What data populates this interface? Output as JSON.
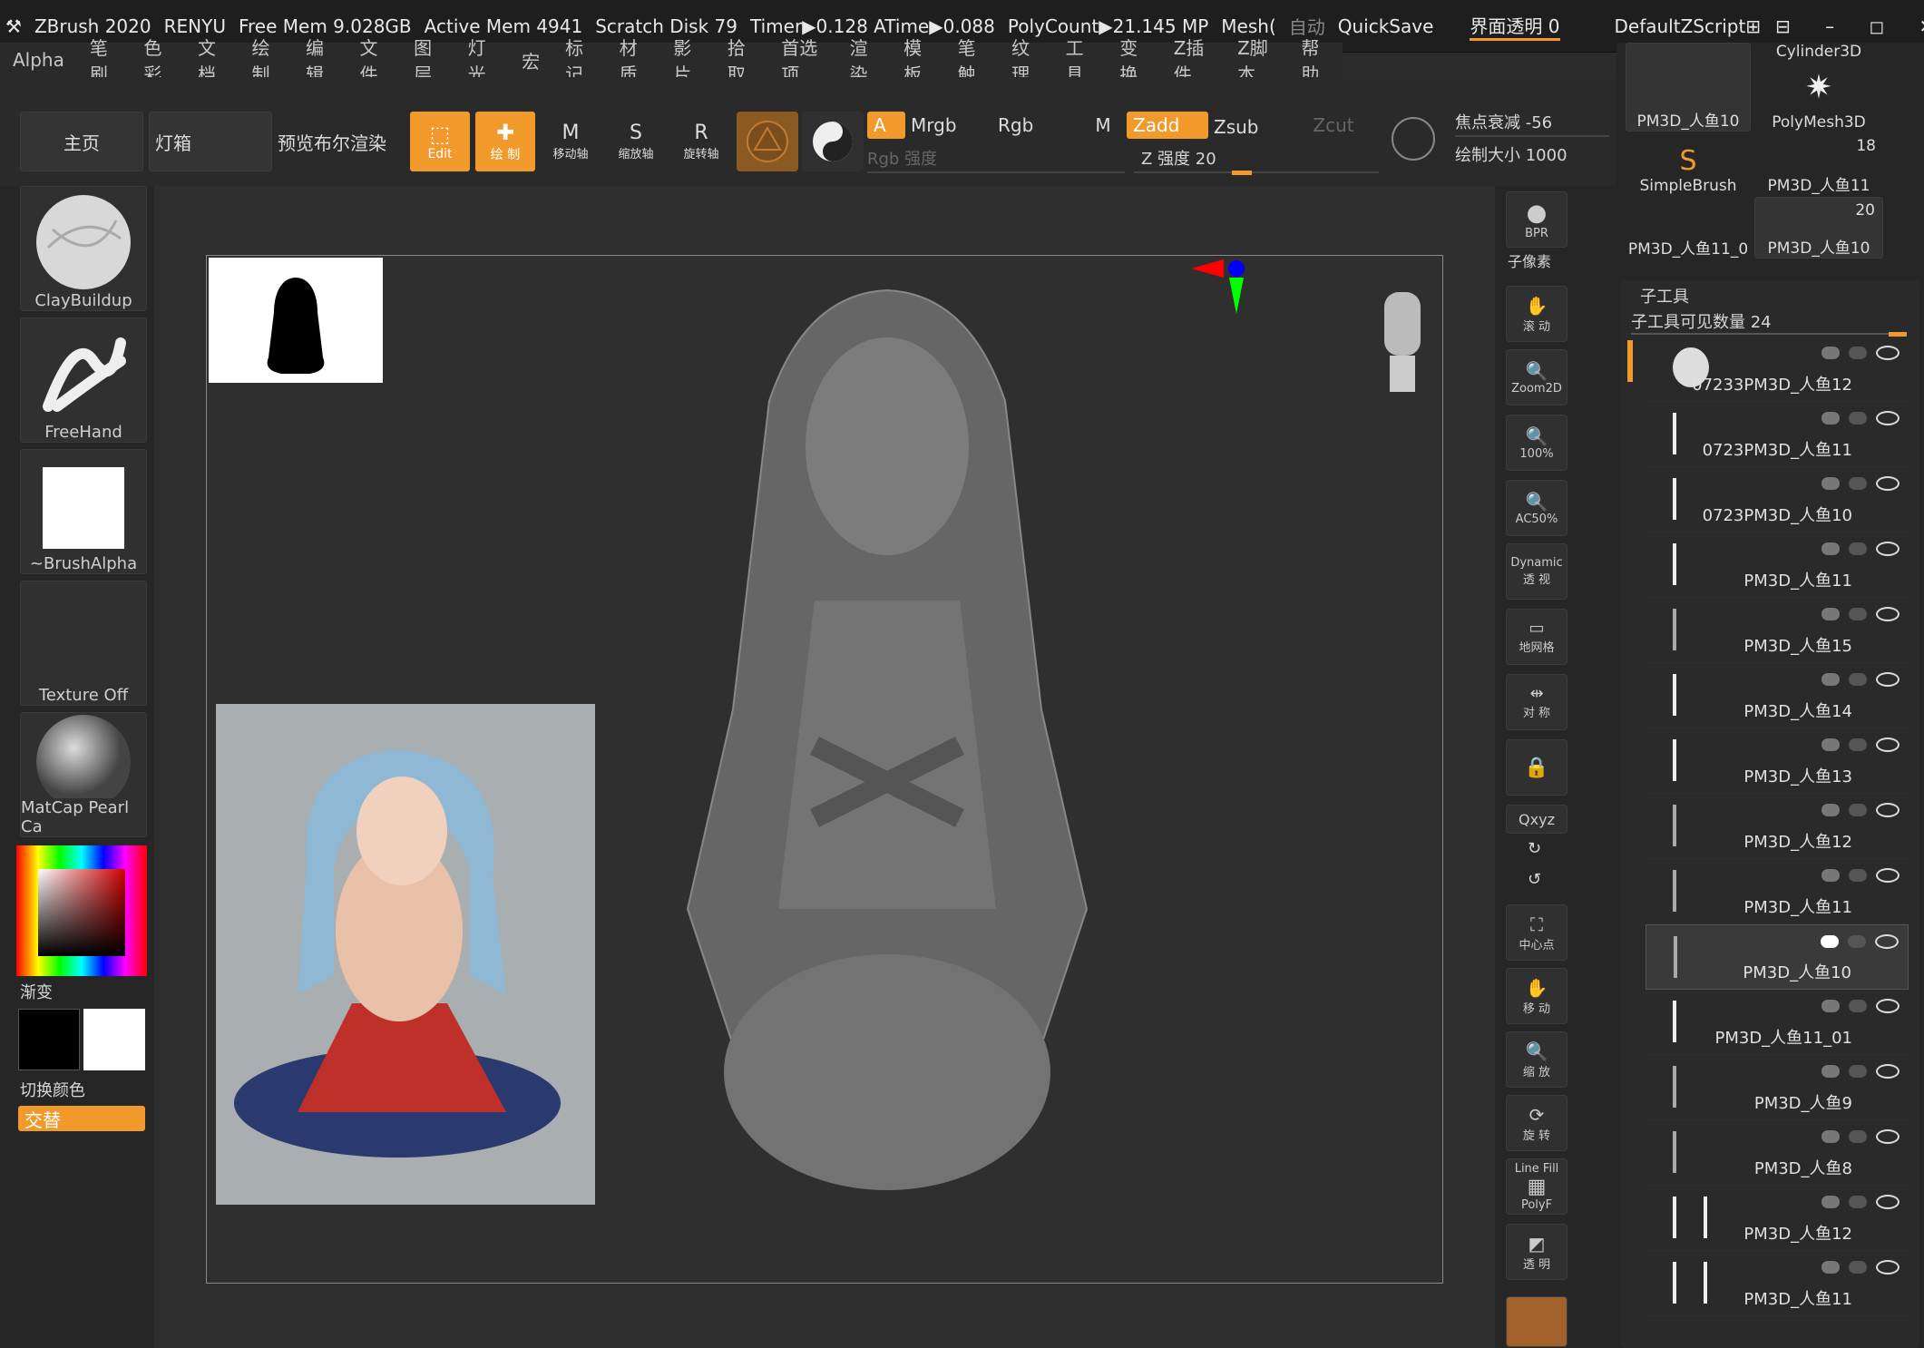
{
  "topbar": {
    "app": "ZBrush 2020",
    "user": "RENYU",
    "free_mem": "Free Mem 9.028GB",
    "active_mem": "Active Mem 4941",
    "scratch": "Scratch Disk 79",
    "timer": "Timer▶0.128 ATime▶0.088",
    "polycount": "PolyCount▶21.145 MP",
    "mesh": "Mesh(",
    "auto": "自动",
    "quicksave": "QuickSave",
    "transparency": "界面透明 0",
    "script": "DefaultZScript"
  },
  "menu": [
    "Alpha",
    "笔刷",
    "色彩",
    "文档",
    "绘制",
    "编辑",
    "文件",
    "图层",
    "灯光",
    "宏",
    "标记",
    "材质",
    "影片",
    "拾取",
    "首选项",
    "渲染",
    "模板",
    "笔触",
    "纹理",
    "工具",
    "变换",
    "Z插件",
    "Z脚本",
    "帮助"
  ],
  "shelf": {
    "home": "主页",
    "lightbox": "灯箱",
    "preview_bool": "预览布尔渲染",
    "edit": "Edit",
    "draw": "绘 制",
    "move": "移动轴",
    "scale": "缩放轴",
    "rotate": "旋转轴",
    "a": "A",
    "mrgb": "Mrgb",
    "rgb": "Rgb",
    "m": "M",
    "zadd": "Zadd",
    "zsub": "Zsub",
    "zcut": "Zcut",
    "rgb_intensity": "Rgb 强度",
    "z_intensity": "Z 强度 20",
    "focal_shift": "焦点衰减 -56",
    "draw_size": "绘制大小 1000"
  },
  "left": {
    "brush": "ClayBuildup",
    "stroke": "FreeHand",
    "alpha": "~BrushAlpha",
    "texture": "Texture Off",
    "matcap": "MatCap Pearl Ca",
    "gradient": "渐变",
    "switch_color": "切换颜色",
    "alternate": "交替"
  },
  "right_strip": {
    "bpr": "BPR",
    "subpixel": "子像素",
    "scroll": "滚 动",
    "zoom2d": "Zoom2D",
    "hundred": "100%",
    "ac50": "AC50%",
    "dynamic": "Dynamic",
    "persp": "透 视",
    "floor": "地网格",
    "sym": "对 称",
    "xyz": "Qxyz",
    "frame": "中心点",
    "move": "移 动",
    "zoom": "缩 放",
    "rotate": "旋 转",
    "polyf": "PolyF",
    "linefill": "Line Fill",
    "transp": "透 明"
  },
  "toolpanel": {
    "top_items": [
      {
        "label": "PM3D_人鱼10"
      },
      {
        "label": "PolyMesh3D",
        "title": "Cylinder3D"
      },
      {
        "label": "SimpleBrush"
      },
      {
        "label": "PM3D_人鱼11",
        "count": "18"
      },
      {
        "label": "PM3D_人鱼11_0"
      },
      {
        "label": "PM3D_人鱼10",
        "count": "20"
      }
    ],
    "subtool_title": "子工具",
    "visible_count": "子工具可见数量 24",
    "subtools": [
      "07233PM3D_人鱼12",
      "0723PM3D_人鱼11",
      "0723PM3D_人鱼10",
      "PM3D_人鱼11",
      "PM3D_人鱼15",
      "PM3D_人鱼14",
      "PM3D_人鱼13",
      "PM3D_人鱼12",
      "PM3D_人鱼11",
      "PM3D_人鱼10",
      "PM3D_人鱼11_01",
      "PM3D_人鱼9",
      "PM3D_人鱼8",
      "PM3D_人鱼12",
      "PM3D_人鱼11"
    ]
  },
  "colors": {
    "accent": "#f19a2b",
    "canvas": "#2f2f2f"
  }
}
